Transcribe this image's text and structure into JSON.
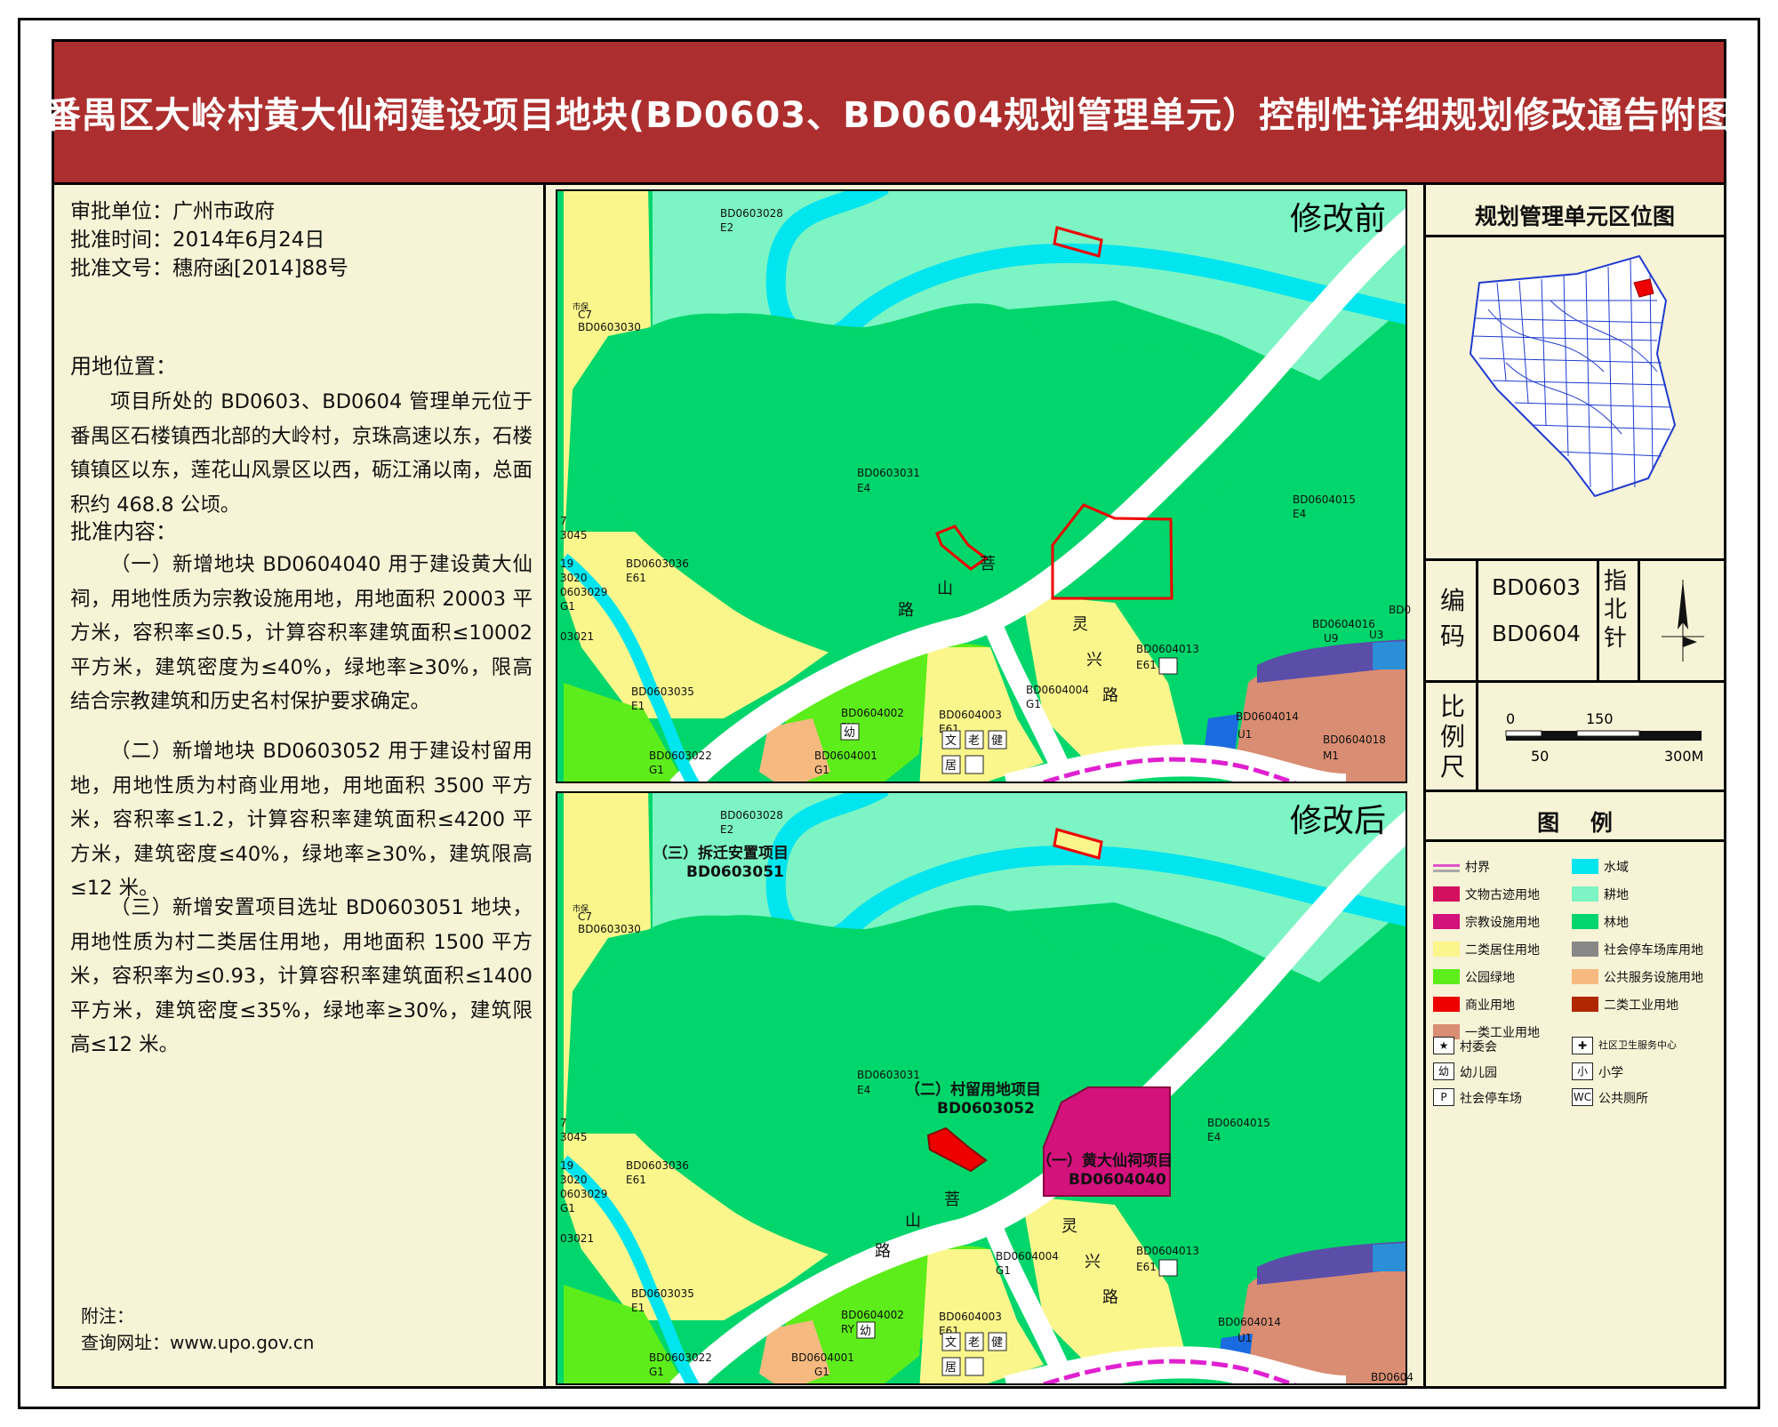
{
  "title": "番禺区大岭村黄大仙祠建设项目地块(BD0603、BD0604规划管理单元）控制性详细规划修改通告附图",
  "approval": {
    "unit_label": "审批单位：",
    "unit": "广州市政府",
    "date_label": "批准时间：",
    "date": "2014年6月24日",
    "doc_label": "批准文号：",
    "doc": "穗府函[2014]88号"
  },
  "location": {
    "heading": "用地位置：",
    "text": "项目所处的 BD0603、BD0604 管理单元位于番禺区石楼镇西北部的大岭村，京珠高速以东，石楼镇镇区以东，莲花山风景区以西，砺江涌以南，总面积约 468.8 公顷。"
  },
  "content": {
    "heading": "批准内容：",
    "item1": "（一）新增地块 BD0604040 用于建设黄大仙祠，用地性质为宗教设施用地，用地面积 20003 平方米，容积率≤0.5，计算容积率建筑面积≤10002 平方米，建筑密度为≤40%，绿地率≥30%，限高结合宗教建筑和历史名村保护要求确定。",
    "item2": "（二）新增地块 BD0603052 用于建设村留用地，用地性质为村商业用地，用地面积 3500 平方米，容积率≤1.2，计算容积率建筑面积≤4200 平方米，建筑密度≤40%，绿地率≥30%，建筑限高≤12 米。",
    "item3": "（三）新增安置项目选址 BD0603051 地块，用地性质为村二类居住用地，用地面积 1500 平方米，容积率为≤0.93，计算容积率建筑面积≤1400 平方米，建筑密度≤35%，绿地率≥30%，建筑限高≤12 米。"
  },
  "note": {
    "label": "附注：",
    "url_label": "查询网址：",
    "url": "www.upo.gov.cn"
  },
  "maps": {
    "before_label": "修改前",
    "after_label": "修改后",
    "parcels": {
      "p3028": "BD0603028",
      "e2": "E2",
      "p3030": "BD0603030",
      "c7": "C7",
      "shibao": "市保",
      "p3031": "BD0603031",
      "e4": "E4",
      "p3036": "BD0603036",
      "e61": "E61",
      "p4015": "BD0604015",
      "p3045": "7\n3045",
      "p3045a": "7",
      "p3045b": "3045",
      "p19": "19",
      "p3020": "3020",
      "p3029": "0603029",
      "g1": "G1",
      "p3021": "03021",
      "p3035": "BD0603035",
      "e1": "E1",
      "p3022": "BD0603022",
      "p4002": "BD0604002",
      "ry": "RY",
      "you": "幼",
      "p4001": "BD0604001",
      "p4003": "BD0604003",
      "p4004": "BD0604004",
      "p4013": "BD0604013",
      "p4016": "BD0604016",
      "u9": "U9",
      "u3": "U3",
      "bd0": "BD0",
      "p4014": "BD0604014",
      "u1": "U1",
      "p4018": "BD0604018",
      "m1": "M1",
      "bd0604": "BD0604",
      "wen": "文",
      "lao": "老",
      "jian": "健",
      "ju": "居"
    },
    "roads": {
      "pu": "菩",
      "shan": "山",
      "lu": "路",
      "ling": "灵",
      "xing": "兴"
    },
    "annotations": {
      "proj3": "（三）拆迁安置项目",
      "proj3_code": "BD0603051",
      "proj2": "（二）村留用地项目",
      "proj2_code": "BD0603052",
      "proj1": "（一）黄大仙祠项目",
      "proj1_code": "BD0604040"
    }
  },
  "sidebar": {
    "location_title": "规划管理单元区位图",
    "code_label_1": "编",
    "code_label_2": "码",
    "code_1": "BD0603",
    "code_2": "BD0604",
    "north_1": "指",
    "north_2": "北",
    "north_3": "针",
    "scale_1": "比",
    "scale_2": "例",
    "scale_3": "尺",
    "scale_ticks_top": [
      "0",
      "150"
    ],
    "scale_ticks_bottom": [
      "50",
      "300M"
    ],
    "legend_title": "图    例",
    "legend": [
      {
        "label": "村界",
        "color": "#e055c8"
      },
      {
        "label": "水域",
        "color": "#00e5ee"
      },
      {
        "label": "文物古迹用地",
        "color": "#d3105f"
      },
      {
        "label": "耕地",
        "color": "#7cf4c4"
      },
      {
        "label": "宗教设施用地",
        "color": "#d3127b"
      },
      {
        "label": "林地",
        "color": "#00d66b"
      },
      {
        "label": "二类居住用地",
        "color": "#fbf68b"
      },
      {
        "label": "社会停车场库用地",
        "color": "#888888"
      },
      {
        "label": "公园绿地",
        "color": "#5ded1a"
      },
      {
        "label": "公共服务设施用地",
        "color": "#f6ba80"
      },
      {
        "label": "商业用地",
        "color": "#ee0000"
      },
      {
        "label": "二类工业用地",
        "color": "#b02800"
      },
      {
        "label": "一类工业用地",
        "color": "#d98d72"
      }
    ],
    "symbols": [
      {
        "glyph": "★",
        "label": "村委会",
        "icon": "star-icon"
      },
      {
        "glyph": "✚",
        "label": "社区卫生服务中心",
        "icon": "health-center-icon"
      },
      {
        "glyph": "幼",
        "label": "幼儿园",
        "icon": "kindergarten-icon"
      },
      {
        "glyph": "小",
        "label": "小学",
        "icon": "primary-school-icon"
      },
      {
        "glyph": "P",
        "label": "社会停车场",
        "icon": "parking-icon"
      },
      {
        "glyph": "WC",
        "label": "公共厕所",
        "icon": "toilet-icon"
      }
    ]
  }
}
